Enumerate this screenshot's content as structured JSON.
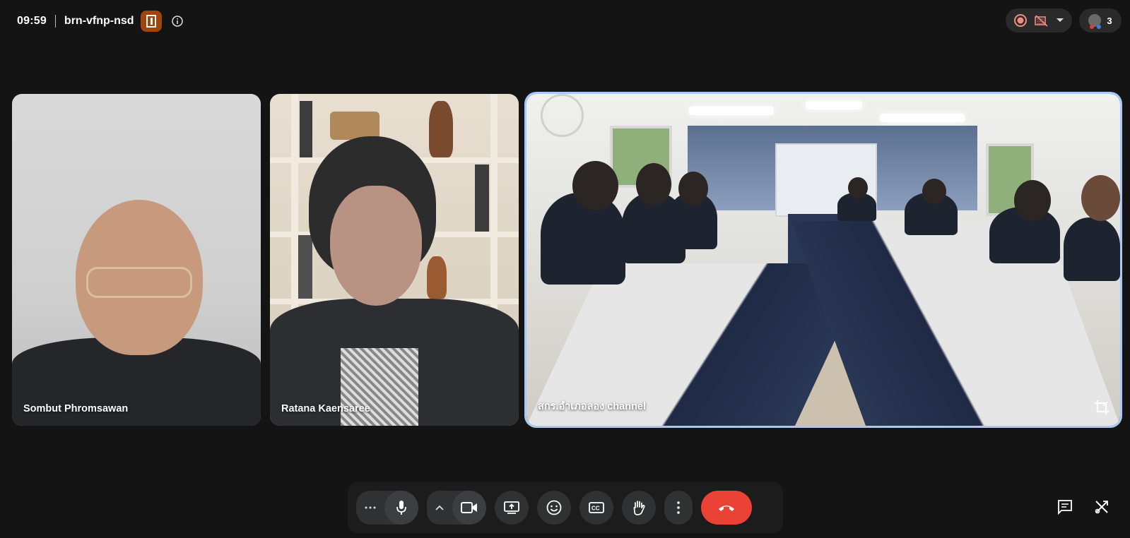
{
  "meeting": {
    "time": "09:59",
    "code": "brn-vfnp-nsd"
  },
  "header": {
    "people_count": "3"
  },
  "participants": [
    {
      "name": "Sombut Phromsawan"
    },
    {
      "name": "Ratana Kaensaree"
    },
    {
      "name": "สกร.อำเภอลอง channel"
    }
  ],
  "icons": {
    "host": "host-controls-icon",
    "info": "info-icon",
    "record": "recording-icon",
    "hidden_cam": "no-camera-icon",
    "dropdown": "chevron-down-icon",
    "people": "people-icon",
    "crop": "crop-icon",
    "more_options": "more-horiz-icon",
    "mic": "mic-icon",
    "expand": "chevron-up-icon",
    "camera": "videocam-icon",
    "present": "present-screen-icon",
    "reactions": "emoji-icon",
    "captions": "captions-icon",
    "raise_hand": "hand-icon",
    "more_vert": "more-vert-icon",
    "end_call": "call-end-icon",
    "chat": "chat-icon",
    "activities": "activities-icon"
  },
  "colors": {
    "background": "#141414",
    "end_call": "#ea4335",
    "host_badge": "#a0460d",
    "active_speaker": "#a9c7fa",
    "control": "#2f3133"
  }
}
